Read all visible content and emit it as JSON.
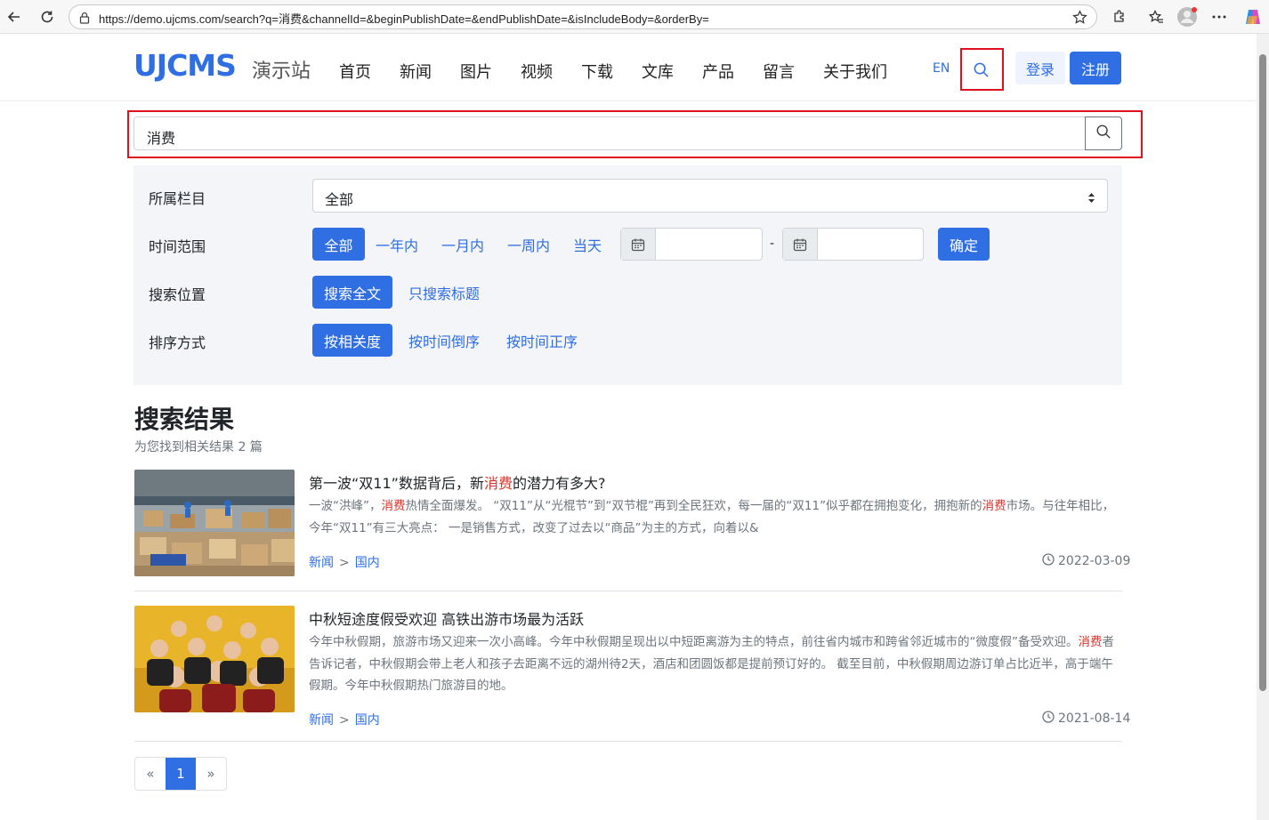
{
  "browser": {
    "url": "https://demo.ujcms.com/search?q=消费&channelId=&beginPublishDate=&endPublishDate=&isIncludeBody=&orderBy="
  },
  "header": {
    "logo": "UJCMS",
    "logo_sub": "演示站",
    "nav": [
      "首页",
      "新闻",
      "图片",
      "视频",
      "下载",
      "文库",
      "产品",
      "留言",
      "关于我们"
    ],
    "lang": "EN",
    "login": "登录",
    "register": "注册"
  },
  "search": {
    "query": "消费"
  },
  "filters": {
    "column_label": "所属栏目",
    "column_value": "全部",
    "time_label": "时间范围",
    "time_options": [
      "全部",
      "一年内",
      "一月内",
      "一周内",
      "当天"
    ],
    "time_selected": "全部",
    "date_separator": "-",
    "confirm": "确定",
    "position_label": "搜索位置",
    "position_options": [
      "搜索全文",
      "只搜索标题"
    ],
    "order_label": "排序方式",
    "order_options": [
      "按相关度",
      "按时间倒序",
      "按时间正序"
    ]
  },
  "results": {
    "heading": "搜索结果",
    "count_text": "为您找到相关结果 2 篇",
    "items": [
      {
        "title_pre": "第一波“双11”数据背后，新",
        "title_hl": "消费",
        "title_post": "的潜力有多大?",
        "desc_1": "一波“洪峰”，",
        "desc_hl1": "消费",
        "desc_2": "热情全面爆发。 “双11”从“光棍节”到“双节棍”再到全民狂欢，每一届的“双11”似乎都在拥抱变化，拥抱新的",
        "desc_hl2": "消费",
        "desc_3": "市场。与往年相比，今年“双11”有三大亮点： 一是销售方式，改变了过去以“商品”为主的方式，向着以&",
        "crumb_1": "新闻",
        "crumb_sep": ">",
        "crumb_2": "国内",
        "date": "2022-03-09"
      },
      {
        "title": "中秋短途度假受欢迎 高铁出游市场最为活跃",
        "desc_1": "今年中秋假期，旅游市场又迎来一次小高峰。今年中秋假期呈现出以中短距离游为主的特点，前往省内城市和跨省邻近城市的“微度假”备受欢迎。",
        "desc_hl": "消费",
        "desc_2": "者告诉记者，中秋假期会带上老人和孩子去距离不远的湖州待2天，酒店和团圆饭都是提前预订好的。 截至目前，中秋假期周边游订单占比近半，高于端午假期。今年中秋假期热门旅游目的地。",
        "crumb_1": "新闻",
        "crumb_sep": ">",
        "crumb_2": "国内",
        "date": "2021-08-14"
      }
    ]
  },
  "pager": {
    "prev": "«",
    "current": "1",
    "next": "»"
  }
}
